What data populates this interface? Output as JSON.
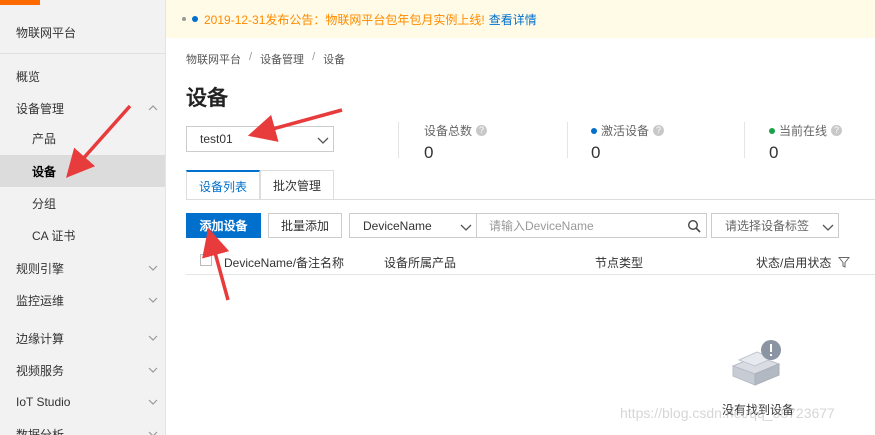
{
  "sidebar": {
    "brand": "物联网平台",
    "items": [
      {
        "label": "概览"
      },
      {
        "label": "设备管理"
      },
      {
        "label": "产品"
      },
      {
        "label": "设备"
      },
      {
        "label": "分组"
      },
      {
        "label": "CA 证书"
      },
      {
        "label": "规则引擎"
      },
      {
        "label": "监控运维"
      },
      {
        "label": "边缘计算"
      },
      {
        "label": "视频服务"
      },
      {
        "label": "IoT Studio"
      },
      {
        "label": "数据分析"
      }
    ]
  },
  "notice": {
    "text": "2019-12-31发布公告：物联网平台包年包月实例上线!",
    "link": "查看详情"
  },
  "breadcrumb": [
    "物联网平台",
    "设备管理",
    "设备"
  ],
  "breadcrumb_sep": "/",
  "page_title": "设备",
  "product_select": {
    "value": "test01"
  },
  "stats": [
    {
      "label": "设备总数",
      "value": "0"
    },
    {
      "label": "激活设备",
      "value": "0",
      "dot_color": "#0070cc"
    },
    {
      "label": "当前在线",
      "value": "0",
      "dot_color": "#1aa14a"
    }
  ],
  "help_glyph": "?",
  "tabs": [
    {
      "label": "设备列表"
    },
    {
      "label": "批次管理"
    }
  ],
  "toolbar": {
    "add_device": "添加设备",
    "batch_add": "批量添加",
    "field_select": "DeviceName",
    "search_placeholder": "请输入DeviceName",
    "tag_placeholder": "请选择设备标签"
  },
  "table": {
    "columns": [
      "DeviceName/备注名称",
      "设备所属产品",
      "节点类型",
      "状态/启用状态"
    ]
  },
  "empty": {
    "text": "没有找到设备"
  },
  "watermark": "https://blog.csdn.net/qq_38723677",
  "colors": {
    "accent": "#0070cc",
    "notice_text": "#ff8a00",
    "arrow": "#e83b3b"
  }
}
